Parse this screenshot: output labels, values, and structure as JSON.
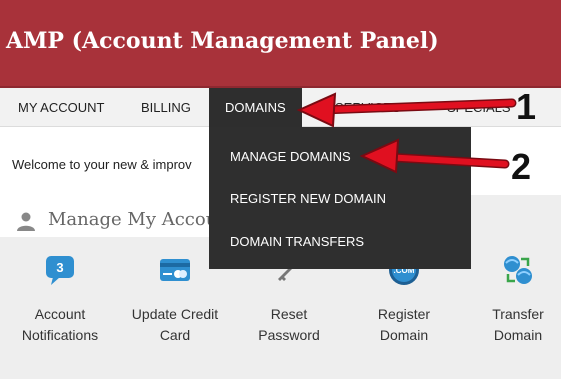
{
  "header": {
    "title": "AMP (Account Management Panel)"
  },
  "nav": {
    "items": [
      "MY ACCOUNT",
      "BILLING",
      "DOMAINS",
      "SERVICES",
      "SPECIALS"
    ],
    "active": "DOMAINS"
  },
  "dropdown": {
    "items": [
      "MANAGE DOMAINS",
      "REGISTER NEW DOMAIN",
      "DOMAIN TRANSFERS"
    ]
  },
  "welcome": {
    "text": "Welcome to your new & improv"
  },
  "panel": {
    "title": "Manage My Account",
    "tiles": [
      {
        "label": "Account\nNotifications",
        "icon": "notification-bubble-icon",
        "badge": "3"
      },
      {
        "label": "Update Credit\nCard",
        "icon": "credit-card-icon"
      },
      {
        "label": "Reset\nPassword",
        "icon": "key-icon"
      },
      {
        "label": "Register\nDomain",
        "icon": "dotcom-globe-icon",
        "badge": ".COM"
      },
      {
        "label": "Transfer\nDomain",
        "icon": "globes-transfer-icon"
      }
    ]
  },
  "annotations": {
    "callout1": "1",
    "callout2": "2"
  },
  "colors": {
    "header": "#a8323a",
    "dropdown": "#2f2f2f",
    "arrow": "#e01020",
    "icon_blue": "#2f8fd0"
  }
}
